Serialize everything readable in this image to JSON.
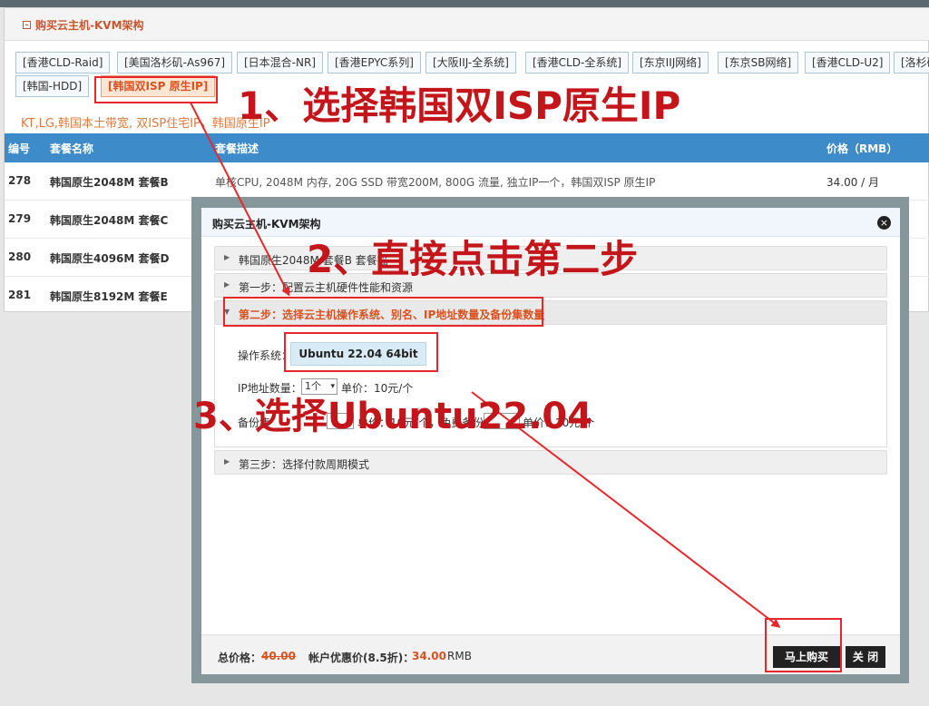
{
  "panel": {
    "title": "购买云主机-KVM架构",
    "tabs": [
      "[香港CLD-Raid]",
      "[美国洛杉矶-As967]",
      "[日本混合-NR]",
      "[香港EPYC系列]",
      "[大阪IIJ-全系统]",
      "[香港CLD-全系统]",
      "[东京IIJ网络]",
      "[东京SB网络]",
      "[香港CLD-U2]",
      "[洛杉矶",
      "[韩国-HDD]",
      "[韩国双ISP 原生IP]"
    ],
    "product_description": "KT,LG,韩国本土带宽, 双ISP住宅IP，韩国原生IP"
  },
  "table": {
    "headers": {
      "id": "编号",
      "name": "套餐名称",
      "desc": "套餐描述",
      "price": "价格（RMB）"
    },
    "rows": [
      {
        "id": "278",
        "name": "韩国原生2048M 套餐B",
        "desc": "单核CPU, 2048M 内存, 20G SSD 带宽200M, 800G 流量, 独立IP一个，韩国双ISP 原生IP",
        "price": "34.00 / 月"
      },
      {
        "id": "279",
        "name": "韩国原生2048M 套餐C",
        "desc": "",
        "price": ""
      },
      {
        "id": "280",
        "name": "韩国原生4096M 套餐D",
        "desc": "",
        "price": ""
      },
      {
        "id": "281",
        "name": "韩国原生8192M 套餐E",
        "desc": "",
        "price": ""
      }
    ]
  },
  "modal": {
    "title": "购买云主机-KVM架构",
    "close_icon": "×",
    "sections": {
      "product": "韩国原生2048M 套餐B 套餐描",
      "step1": "第一步：配置云主机硬件性能和资源",
      "step2": "第二步：选择云主机操作系统、别名、IP地址数量及备份集数量",
      "step3": "第三步：选择付款周期模式"
    },
    "os_label": "操作系统：",
    "os_value": "Ubuntu 22.04 64bit",
    "ip_label": "IP地址数量：",
    "ip_select": "1个",
    "ip_unit_price": "单价：10元/个",
    "backup_label": "备份集",
    "backup_text": "单价：10元/个，免费备份",
    "backup_unit_price": "单价：20元/个",
    "footer": {
      "total_label": "总价格：",
      "total_original": "40.00",
      "member_label": "帐户优惠价(8.5折)：",
      "member_price": "34.00",
      "currency": "RMB",
      "buy_button": "马上购买",
      "close_button": "关 闭"
    }
  },
  "annotations": {
    "step1": "1、选择韩国双ISP原生IP",
    "step2": "2、直接点击第二步",
    "step3": "3、选择Ubuntu22.04",
    "color": "#c4151a",
    "highlight_color": "#e8272b"
  },
  "colors": {
    "accent_orange": "#d9521f",
    "table_header_blue": "#3d8bc9",
    "modal_frame": "#86979b"
  }
}
